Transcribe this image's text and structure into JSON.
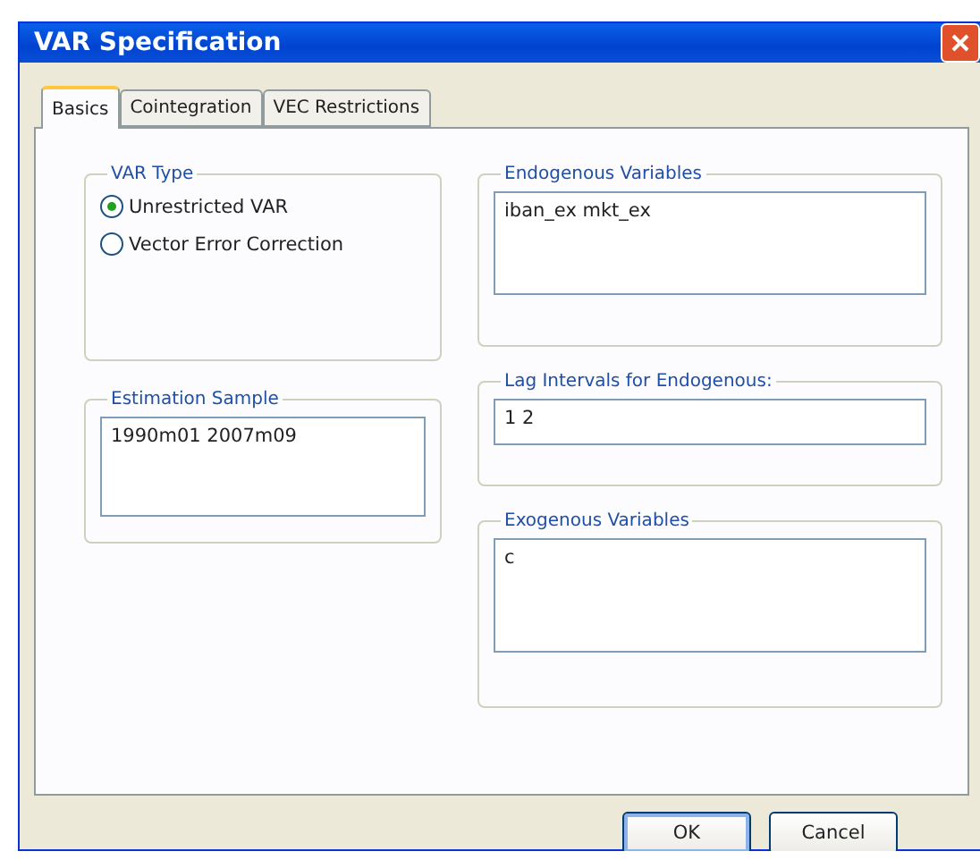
{
  "window": {
    "title": "VAR Specification"
  },
  "tabs": [
    {
      "label": "Basics",
      "selected": true
    },
    {
      "label": "Cointegration",
      "selected": false
    },
    {
      "label": "VEC Restrictions",
      "selected": false
    }
  ],
  "var_type": {
    "label": "VAR Type",
    "options": [
      {
        "label": "Unrestricted VAR",
        "selected": true
      },
      {
        "label": "Vector Error Correction",
        "selected": false
      }
    ]
  },
  "estimation_sample": {
    "label": "Estimation Sample",
    "value": "1990m01 2007m09"
  },
  "endogenous_variables": {
    "label": "Endogenous Variables",
    "value": "iban_ex mkt_ex"
  },
  "lag_intervals": {
    "label": "Lag Intervals for Endogenous:",
    "value": "1 2"
  },
  "exogenous_variables": {
    "label": "Exogenous Variables",
    "value": "c"
  },
  "buttons": [
    {
      "label": "OK",
      "default": true
    },
    {
      "label": "Cancel",
      "default": false
    }
  ]
}
